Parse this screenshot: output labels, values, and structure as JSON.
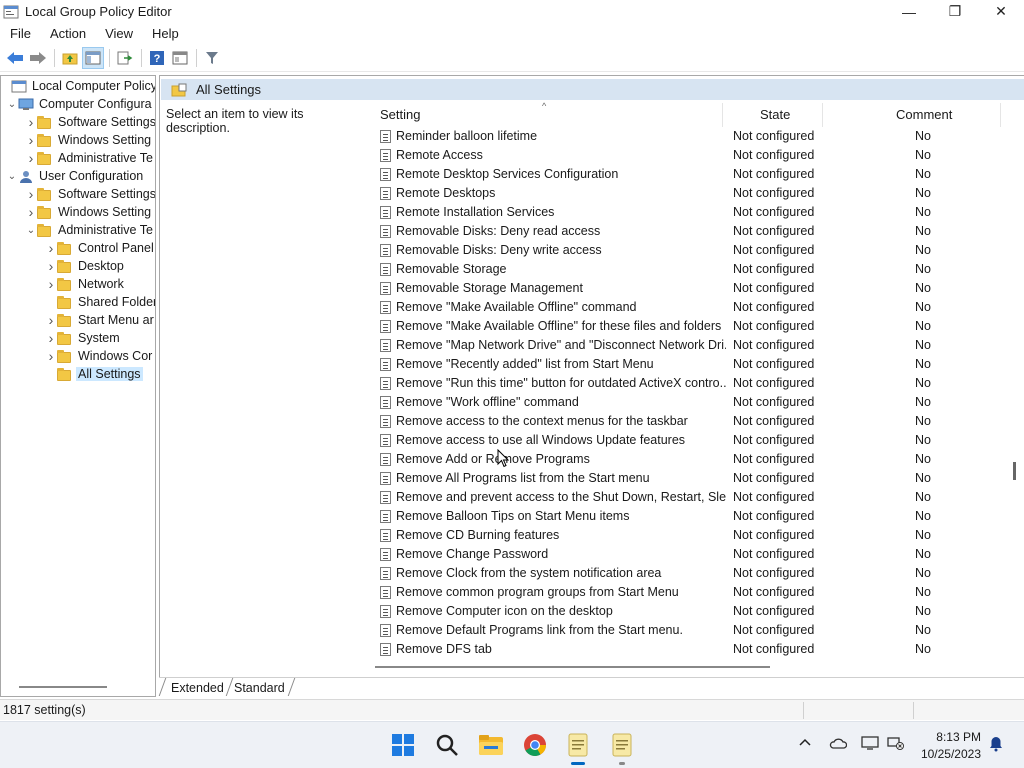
{
  "window": {
    "title": "Local Group Policy Editor",
    "minimize": "—",
    "maximize": "❐",
    "close": "✕"
  },
  "menu": [
    "File",
    "Action",
    "View",
    "Help"
  ],
  "toolbar": {
    "icons": [
      "back-icon",
      "forward-icon",
      "up-folder-icon",
      "show-hide-tree-icon",
      "export-list-icon",
      "help-icon",
      "properties-icon",
      "filter-icon"
    ]
  },
  "tree": [
    {
      "label": "Local Computer Policy",
      "indent": 0,
      "chevron": "",
      "icon": "policy",
      "selected": false
    },
    {
      "label": "Computer Configura",
      "indent": 1,
      "chevron": "v",
      "icon": "computer",
      "selected": false
    },
    {
      "label": "Software Settings",
      "indent": 2,
      "chevron": ">",
      "icon": "folder",
      "selected": false
    },
    {
      "label": "Windows Setting",
      "indent": 2,
      "chevron": ">",
      "icon": "folder",
      "selected": false
    },
    {
      "label": "Administrative Te",
      "indent": 2,
      "chevron": ">",
      "icon": "folder",
      "selected": false
    },
    {
      "label": "User Configuration",
      "indent": 1,
      "chevron": "v",
      "icon": "user",
      "selected": false
    },
    {
      "label": "Software Settings",
      "indent": 2,
      "chevron": ">",
      "icon": "folder",
      "selected": false
    },
    {
      "label": "Windows Setting",
      "indent": 2,
      "chevron": ">",
      "icon": "folder",
      "selected": false
    },
    {
      "label": "Administrative Te",
      "indent": 2,
      "chevron": "v",
      "icon": "folder",
      "selected": false
    },
    {
      "label": "Control Panel",
      "indent": 3,
      "chevron": ">",
      "icon": "folder",
      "selected": false
    },
    {
      "label": "Desktop",
      "indent": 3,
      "chevron": ">",
      "icon": "folder",
      "selected": false
    },
    {
      "label": "Network",
      "indent": 3,
      "chevron": ">",
      "icon": "folder",
      "selected": false
    },
    {
      "label": "Shared Folder",
      "indent": 3,
      "chevron": "",
      "icon": "folder",
      "selected": false
    },
    {
      "label": "Start Menu ar",
      "indent": 3,
      "chevron": ">",
      "icon": "folder",
      "selected": false
    },
    {
      "label": "System",
      "indent": 3,
      "chevron": ">",
      "icon": "folder",
      "selected": false
    },
    {
      "label": "Windows Cor",
      "indent": 3,
      "chevron": ">",
      "icon": "folder",
      "selected": false
    },
    {
      "label": "All Settings",
      "indent": 3,
      "chevron": "",
      "icon": "folder",
      "selected": true
    }
  ],
  "right_pane": {
    "header": "All Settings",
    "description": "Select an item to view its description.",
    "columns": {
      "setting": "Setting",
      "state": "State",
      "comment": "Comment"
    },
    "rows": [
      {
        "name": "Reminder balloon lifetime",
        "state": "Not configured",
        "comment": "No"
      },
      {
        "name": "Remote Access",
        "state": "Not configured",
        "comment": "No"
      },
      {
        "name": "Remote Desktop Services Configuration",
        "state": "Not configured",
        "comment": "No"
      },
      {
        "name": "Remote Desktops",
        "state": "Not configured",
        "comment": "No"
      },
      {
        "name": "Remote Installation Services",
        "state": "Not configured",
        "comment": "No"
      },
      {
        "name": "Removable Disks: Deny read access",
        "state": "Not configured",
        "comment": "No"
      },
      {
        "name": "Removable Disks: Deny write access",
        "state": "Not configured",
        "comment": "No"
      },
      {
        "name": "Removable Storage",
        "state": "Not configured",
        "comment": "No"
      },
      {
        "name": "Removable Storage Management",
        "state": "Not configured",
        "comment": "No"
      },
      {
        "name": "Remove \"Make Available Offline\" command",
        "state": "Not configured",
        "comment": "No"
      },
      {
        "name": "Remove \"Make Available Offline\" for these files and folders",
        "state": "Not configured",
        "comment": "No"
      },
      {
        "name": "Remove \"Map Network Drive\" and \"Disconnect Network Dri...",
        "state": "Not configured",
        "comment": "No"
      },
      {
        "name": "Remove \"Recently added\" list from Start Menu",
        "state": "Not configured",
        "comment": "No"
      },
      {
        "name": "Remove \"Run this time\" button for outdated ActiveX contro...",
        "state": "Not configured",
        "comment": "No"
      },
      {
        "name": "Remove \"Work offline\" command",
        "state": "Not configured",
        "comment": "No"
      },
      {
        "name": "Remove access to the context menus for the taskbar",
        "state": "Not configured",
        "comment": "No"
      },
      {
        "name": "Remove access to use all Windows Update features",
        "state": "Not configured",
        "comment": "No"
      },
      {
        "name": "Remove Add or Remove Programs",
        "state": "Not configured",
        "comment": "No"
      },
      {
        "name": "Remove All Programs list from the Start menu",
        "state": "Not configured",
        "comment": "No"
      },
      {
        "name": "Remove and prevent access to the Shut Down, Restart, Sleep...",
        "state": "Not configured",
        "comment": "No"
      },
      {
        "name": "Remove Balloon Tips on Start Menu items",
        "state": "Not configured",
        "comment": "No"
      },
      {
        "name": "Remove CD Burning features",
        "state": "Not configured",
        "comment": "No"
      },
      {
        "name": "Remove Change Password",
        "state": "Not configured",
        "comment": "No"
      },
      {
        "name": "Remove Clock from the system notification area",
        "state": "Not configured",
        "comment": "No"
      },
      {
        "name": "Remove common program groups from Start Menu",
        "state": "Not configured",
        "comment": "No"
      },
      {
        "name": "Remove Computer icon on the desktop",
        "state": "Not configured",
        "comment": "No"
      },
      {
        "name": "Remove Default Programs link from the Start menu.",
        "state": "Not configured",
        "comment": "No"
      },
      {
        "name": "Remove DFS tab",
        "state": "Not configured",
        "comment": "No"
      }
    ]
  },
  "tabs": {
    "extended": "Extended",
    "standard": "Standard"
  },
  "status": {
    "count": "1817 setting(s)"
  },
  "taskbar": {
    "apps": [
      "windows-start-icon",
      "search-icon",
      "file-explorer-icon",
      "chrome-icon",
      "notepad-icon",
      "notepad-icon-2"
    ],
    "time": "8:13 PM",
    "date": "10/25/2023",
    "tray": [
      "chevron-up-icon",
      "onedrive-icon",
      "display-icon",
      "network-icon",
      "notification-bell-icon"
    ]
  },
  "colors": {
    "header_bg": "#d7e4f2",
    "selection": "#cce8ff",
    "folder": "#f2c744",
    "accent": "#0067c0"
  }
}
